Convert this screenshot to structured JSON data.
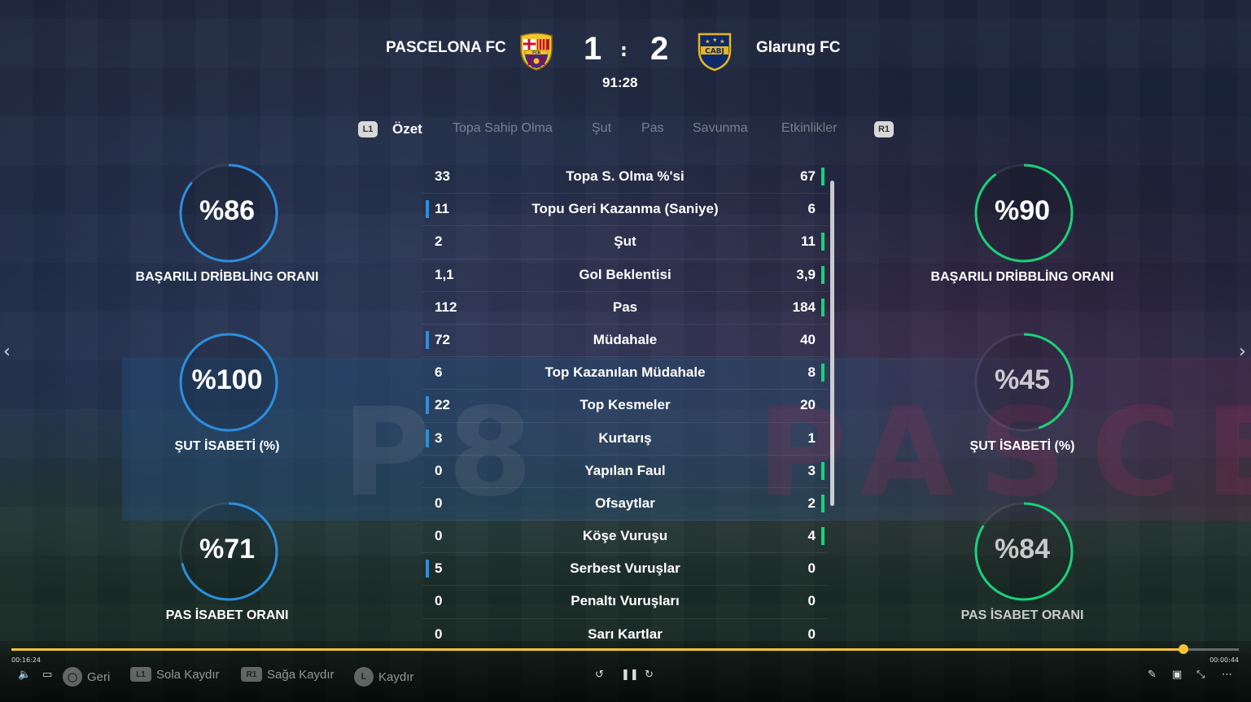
{
  "header": {
    "home_team": "PASCELONA FC",
    "away_team": "Glarung FC",
    "home_score": "1",
    "away_score": "2",
    "separator": ":",
    "clock": "91:28",
    "home_crest_text": "FCB",
    "away_crest_text": "CABJ"
  },
  "tabs": {
    "left_button": "L1",
    "right_button": "R1",
    "items": [
      "Özet",
      "Topa Sahip Olma",
      "Şut",
      "Pas",
      "Savunma",
      "Etkinlikler"
    ],
    "active": "Özet"
  },
  "stats": [
    {
      "label": "Topa S. Olma %'si",
      "home": "33",
      "away": "67",
      "leader": "away"
    },
    {
      "label": "Topu Geri Kazanma (Saniye)",
      "home": "11",
      "away": "6",
      "leader": "home"
    },
    {
      "label": "Şut",
      "home": "2",
      "away": "11",
      "leader": "away"
    },
    {
      "label": "Gol Beklentisi",
      "home": "1,1",
      "away": "3,9",
      "leader": "away"
    },
    {
      "label": "Pas",
      "home": "112",
      "away": "184",
      "leader": "away"
    },
    {
      "label": "Müdahale",
      "home": "72",
      "away": "40",
      "leader": "home"
    },
    {
      "label": "Top Kazanılan Müdahale",
      "home": "6",
      "away": "8",
      "leader": "away"
    },
    {
      "label": "Top Kesmeler",
      "home": "22",
      "away": "20",
      "leader": "home"
    },
    {
      "label": "Kurtarış",
      "home": "3",
      "away": "1",
      "leader": "home"
    },
    {
      "label": "Yapılan Faul",
      "home": "0",
      "away": "3",
      "leader": "away"
    },
    {
      "label": "Ofsaytlar",
      "home": "0",
      "away": "2",
      "leader": "away"
    },
    {
      "label": "Köşe Vuruşu",
      "home": "0",
      "away": "4",
      "leader": "away"
    },
    {
      "label": "Serbest Vuruşlar",
      "home": "5",
      "away": "0",
      "leader": "home"
    },
    {
      "label": "Penaltı Vuruşları",
      "home": "0",
      "away": "0",
      "leader": "none"
    },
    {
      "label": "Sarı Kartlar",
      "home": "0",
      "away": "0",
      "leader": "none"
    }
  ],
  "gauges": {
    "home": [
      {
        "value": "%86",
        "fraction": 0.86,
        "label": "BAŞARILI DRİBBLİNG ORANI"
      },
      {
        "value": "%100",
        "fraction": 1.0,
        "label": "ŞUT İSABETİ (%)"
      },
      {
        "value": "%71",
        "fraction": 0.71,
        "label": "PAS İSABET ORANI"
      }
    ],
    "away": [
      {
        "value": "%90",
        "fraction": 0.9,
        "label": "BAŞARILI DRİBBLİNG ORANI"
      },
      {
        "value": "%45",
        "fraction": 0.45,
        "label": "ŞUT İSABETİ (%)"
      },
      {
        "value": "%84",
        "fraction": 0.84,
        "label": "PAS İSABET ORANI"
      }
    ]
  },
  "background": {
    "banner_text": "P8",
    "banner_text2": "PASCELO"
  },
  "player": {
    "elapsed": "00:16:24",
    "remaining": "00:00:44",
    "progress": 0.955,
    "controls": [
      {
        "key": "◯",
        "label": "Geri"
      },
      {
        "key": "L1",
        "label": "Sola Kaydır"
      },
      {
        "key": "R1",
        "label": "Sağa Kaydır"
      },
      {
        "key": "L",
        "label": "Kaydır"
      }
    ]
  },
  "colors": {
    "home_accent": "#2a8fe0",
    "away_accent": "#19d27a",
    "progress": "#f5c23a"
  }
}
